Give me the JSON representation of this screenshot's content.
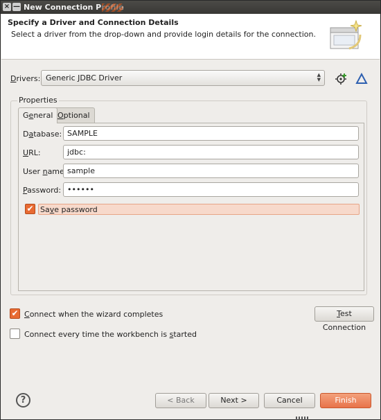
{
  "window": {
    "title": "New Connection Profile",
    "close_glyph": "×",
    "min_glyph": "—"
  },
  "banner": {
    "title": "Specify a Driver and Connection Details",
    "description": "Select a driver from the drop-down and provide login details for the connection."
  },
  "drivers": {
    "label_mnemonic": "D",
    "label_rest": "rivers:",
    "selected": "Generic JDBC Driver",
    "icons": [
      "new-driver-icon",
      "edit-driver-icon"
    ]
  },
  "properties": {
    "group_title": "Properties",
    "tabs": [
      {
        "pre": "G",
        "mn": "e",
        "post": "neral",
        "active": true
      },
      {
        "pre": "",
        "mn": "O",
        "post": "ptional",
        "active": false
      }
    ],
    "fields": {
      "database": {
        "pre": "D",
        "mn": "a",
        "post": "tabase:",
        "value": "SAMPLE"
      },
      "url": {
        "pre": "",
        "mn": "U",
        "post": "RL:",
        "value": "jdbc:"
      },
      "username": {
        "pre": "User ",
        "mn": "n",
        "post": "ame:",
        "value": "sample"
      },
      "password": {
        "pre": "",
        "mn": "P",
        "post": "assword:",
        "value": "••••••"
      }
    },
    "save_password": {
      "pre": "Sa",
      "mn": "v",
      "post": "e password",
      "checked": true
    }
  },
  "options": {
    "connect_on_finish": {
      "pre": "",
      "mn": "C",
      "post": "onnect when the wizard completes",
      "checked": true
    },
    "connect_on_start": {
      "pre": "Connect every time the workbench is ",
      "mn": "s",
      "post": "tarted",
      "checked": false
    },
    "test_connection": {
      "pre": "",
      "mn": "T",
      "post": "est Connection"
    }
  },
  "footer": {
    "help_glyph": "?",
    "back": "< Back",
    "next": "Next >",
    "cancel": "Cancel",
    "finish": "Finish"
  },
  "colors": {
    "accent": "#e86a32",
    "window_bg": "#efedea",
    "title_bar": "#3c3b37"
  }
}
